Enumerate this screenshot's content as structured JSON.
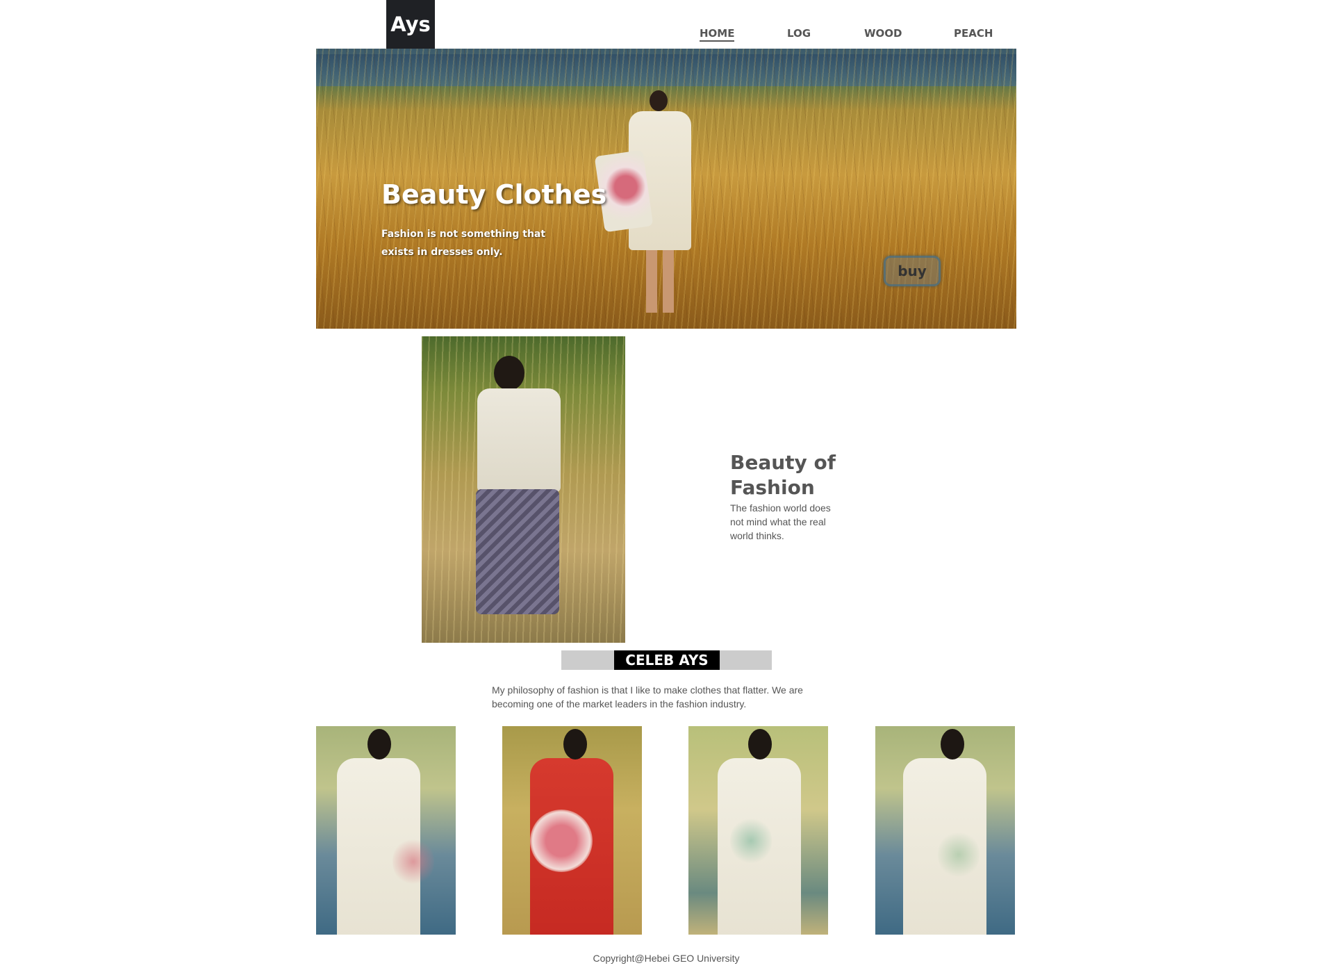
{
  "header": {
    "logo": "Ays",
    "nav": [
      {
        "label": "HOME",
        "active": true
      },
      {
        "label": "LOG",
        "active": false
      },
      {
        "label": "WOOD",
        "active": false
      },
      {
        "label": "PEACH",
        "active": false
      }
    ]
  },
  "hero": {
    "title": "Beauty Clothes",
    "subtitle": "Fashion is not something that exists in dresses only.",
    "button_label": "buy"
  },
  "feature": {
    "title": "Beauty of Fashion",
    "text": "The fashion world does not mind what the real world thinks."
  },
  "celeb": {
    "label": "CELEB AYS",
    "philosophy": "My philosophy of fashion is that I like to make clothes that flatter. We are becoming one of the market leaders in the fashion industry."
  },
  "gallery": {
    "count": 4
  },
  "footer": {
    "copyright": "Copyright@Hebei GEO University"
  },
  "colors": {
    "logo_bg": "#1f2125",
    "text": "#555555",
    "celeb_bar": "#cccccc",
    "celeb_label_bg": "#000000"
  }
}
